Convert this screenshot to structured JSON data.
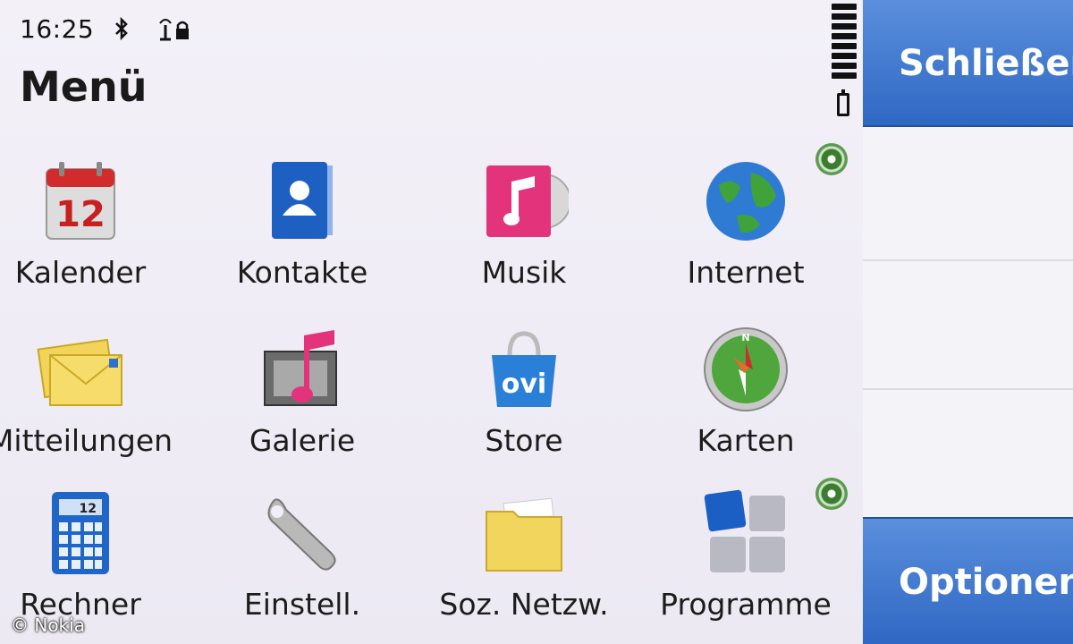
{
  "status": {
    "time": "16:25"
  },
  "title": "Menü",
  "apps": [
    {
      "label": "Kalender",
      "icon": "calendar-icon",
      "day": "12"
    },
    {
      "label": "Kontakte",
      "icon": "contacts-icon"
    },
    {
      "label": "Musik",
      "icon": "music-icon"
    },
    {
      "label": "Internet",
      "icon": "globe-icon"
    },
    {
      "label": "Mitteilungen",
      "icon": "envelope-icon"
    },
    {
      "label": "Galerie",
      "icon": "gallery-icon"
    },
    {
      "label": "Store",
      "icon": "store-bag-icon",
      "badge": "ovi"
    },
    {
      "label": "Karten",
      "icon": "compass-icon"
    },
    {
      "label": "Rechner",
      "icon": "calculator-icon",
      "display": "12"
    },
    {
      "label": "Einstell.",
      "icon": "wrench-icon"
    },
    {
      "label": "Soz. Netzw.",
      "icon": "folder-icon"
    },
    {
      "label": "Programme",
      "icon": "apps-grid-icon"
    }
  ],
  "softkeys": {
    "top": "Schließen",
    "bottom": "Optionen"
  },
  "copyright": "© Nokia",
  "colors": {
    "softkey": "#3b74cf",
    "background": "#f1eef6"
  }
}
